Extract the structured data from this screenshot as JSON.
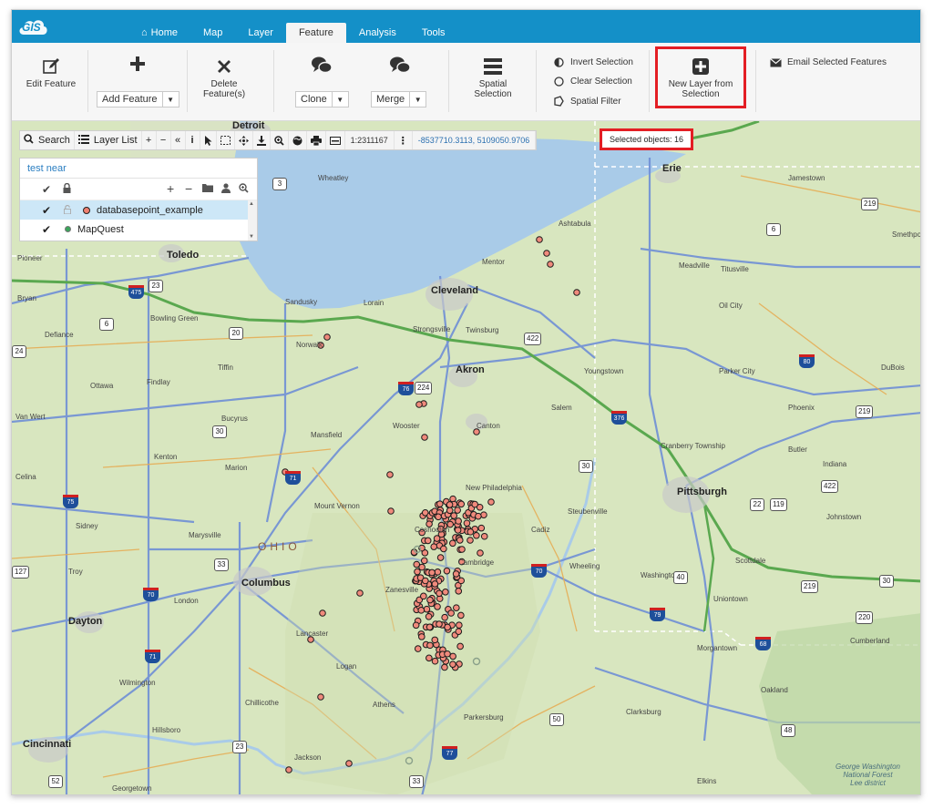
{
  "app": {
    "logo_text": "GIS"
  },
  "nav": {
    "tabs": [
      {
        "label": "Home"
      },
      {
        "label": "Map"
      },
      {
        "label": "Layer"
      },
      {
        "label": "Feature",
        "active": true
      },
      {
        "label": "Analysis"
      },
      {
        "label": "Tools"
      }
    ]
  },
  "ribbon": {
    "edit_feature": "Edit Feature",
    "add_feature": "Add Feature",
    "delete_feature_line1": "Delete",
    "delete_feature_line2": "Feature(s)",
    "clone": "Clone",
    "merge": "Merge",
    "spatial_selection_line1": "Spatial",
    "spatial_selection_line2": "Selection",
    "invert_selection": "Invert Selection",
    "clear_selection": "Clear Selection",
    "spatial_filter": "Spatial Filter",
    "new_layer_line1": "New Layer from",
    "new_layer_line2": "Selection",
    "email_selected": "Email Selected Features"
  },
  "map_toolbar": {
    "search": "Search",
    "layer_list": "Layer List",
    "scale": "1:2311167",
    "coordinates": "-8537710.3113, 5109050.9706",
    "selected_objects": "Selected objects: 16"
  },
  "layer_panel": {
    "title": "test near",
    "layers": [
      {
        "name": "databasepoint_example",
        "visible": true,
        "selected": true
      },
      {
        "name": "MapQuest",
        "visible": true,
        "selected": false
      }
    ]
  },
  "map": {
    "state_label": "OHIO",
    "cities": [
      "Detroit",
      "Toledo",
      "Cleveland",
      "Akron",
      "Columbus",
      "Dayton",
      "Cincinnati",
      "Pittsburgh",
      "Erie"
    ],
    "places": [
      "Wheatley",
      "Pioneer",
      "Bryan",
      "Defiance",
      "Bowling Green",
      "Sandusky",
      "Norwalk",
      "Lorain",
      "Strongsville",
      "Twinsburg",
      "Mentor",
      "Ashtabula",
      "Jamestown",
      "Meadville",
      "Titusville",
      "Oil City",
      "Parker City",
      "Youngstown",
      "Salem",
      "Canton",
      "Wooster",
      "Mansfield",
      "Bucyrus",
      "Tiffin",
      "Findlay",
      "Ottawa",
      "Van Wert",
      "Kenton",
      "Marion",
      "Celina",
      "Sidney",
      "Marysville",
      "Mount Vernon",
      "New Philadelphia",
      "Coshocton",
      "Zanesville",
      "Cambridge",
      "Cadiz",
      "Steubenville",
      "Wheeling",
      "Washington",
      "Cranberry Township",
      "Phoenix",
      "Butler",
      "Indiana",
      "Johnstown",
      "Scottdale",
      "Uniontown",
      "Morgantown",
      "Clarksburg",
      "Parkersburg",
      "Athens",
      "Lancaster",
      "Logan",
      "Chillicothe",
      "London",
      "Troy",
      "Wilmington",
      "Hillsboro",
      "Jackson",
      "Georgetown",
      "Oakland",
      "Cumberland",
      "Elkins",
      "DuBois",
      "Smethport"
    ],
    "attribution_line1": "George Washington",
    "attribution_line2": "National Forest",
    "attribution_line3": "Lee district"
  }
}
